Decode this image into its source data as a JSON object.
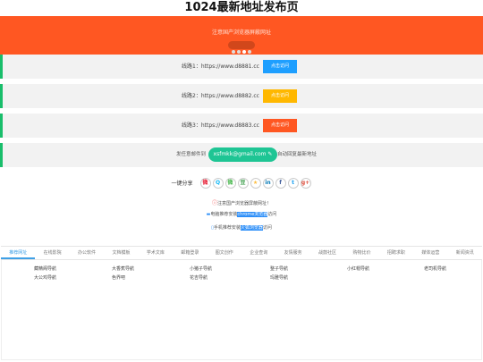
{
  "page": {
    "title": "1024最新地址发布页"
  },
  "banner": {
    "text": "注意国产浏览器屏蔽网址",
    "dots": 4,
    "active_dot": 2
  },
  "routes": [
    {
      "label": "线路1：https://www.d8881.cc",
      "button": "点击访问",
      "color": "#1e9fff"
    },
    {
      "label": "线路2：https://www.d8882.cc",
      "button": "点击访问",
      "color": "#ffb800"
    },
    {
      "label": "线路3：https://www.d8883.cc",
      "button": "点击访问",
      "color": "#ff5722"
    }
  ],
  "email_row": {
    "tip_left": "发任意邮件到",
    "email": "xsfmkk@gmail.com",
    "tip_right": "自动回复最新地址"
  },
  "share": {
    "label": "一键分享",
    "icons": [
      {
        "name": "weibo-icon",
        "glyph": "微",
        "color": "#e6162d"
      },
      {
        "name": "qq-icon",
        "glyph": "Q",
        "color": "#12b7f5"
      },
      {
        "name": "wechat-icon",
        "glyph": "微",
        "color": "#44b549"
      },
      {
        "name": "douban-icon",
        "glyph": "豆",
        "color": "#2e963d"
      },
      {
        "name": "qzone-icon",
        "glyph": "★",
        "color": "#fdbe3d"
      },
      {
        "name": "linkedin-icon",
        "glyph": "in",
        "color": "#0077b5"
      },
      {
        "name": "facebook-icon",
        "glyph": "f",
        "color": "#3b5998"
      },
      {
        "name": "twitter-icon",
        "glyph": "t",
        "color": "#1da1f2"
      },
      {
        "name": "google-plus-icon",
        "glyph": "g+",
        "color": "#dd4b39"
      }
    ]
  },
  "notice": {
    "line1": "注意国产浏览器屏蔽网址！",
    "line2_pre": "电脑推荐安装",
    "line2_hl": "chrome浏览器",
    "line2_post": "访问",
    "line3_pre": "手机推荐安装",
    "line3_hl": "火狐浏览器",
    "line3_post": "访问"
  },
  "tabs": [
    "推荐网址",
    "在线影院",
    "办公软件",
    "文档模板",
    "学术文库",
    "邮箱登录",
    "图文创作",
    "企业查询",
    "友情服务",
    "战鼓社区",
    "购物比价",
    "招聘求职",
    "媒体运营",
    "新闻资讯"
  ],
  "active_tab": 0,
  "links": [
    [
      "藏精阁导航",
      "大香蕉导航",
      "小猪子导航",
      "整子导航",
      "小红帽导航",
      "老司机导航"
    ],
    [
      "大公鸡导航",
      "色界吧",
      "花吉导航",
      "玛雅导航"
    ]
  ]
}
